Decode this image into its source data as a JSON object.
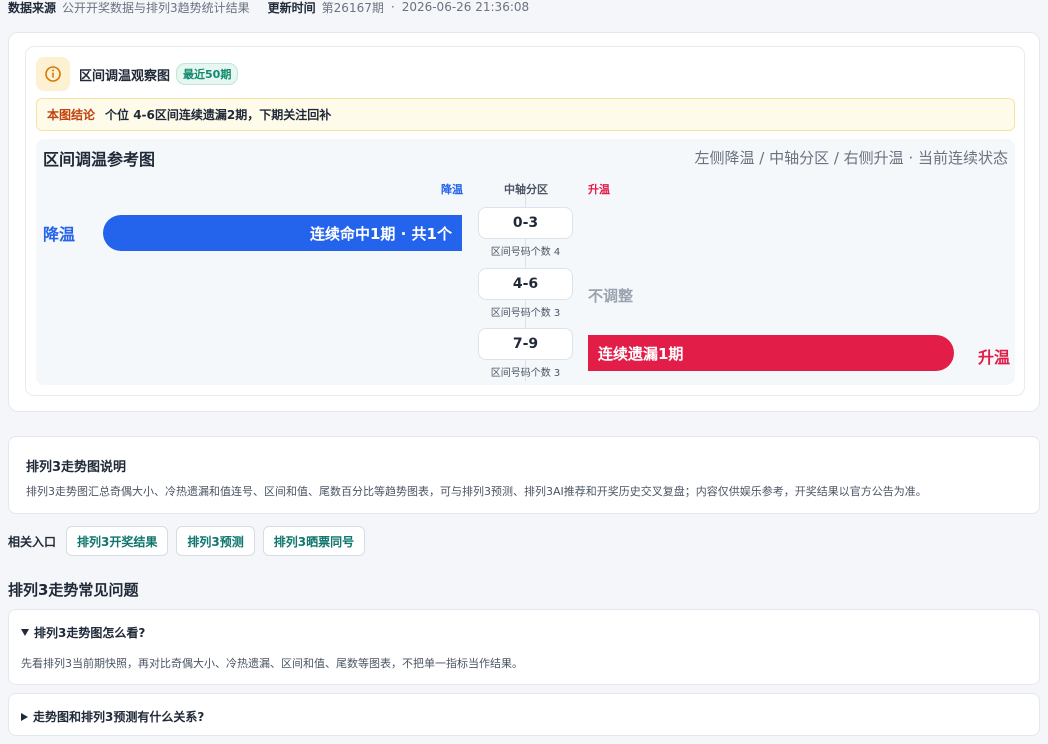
{
  "meta": {
    "source_label": "数据来源",
    "source_value": "公开开奖数据与排列3趋势统计结果",
    "update_label": "更新时间",
    "issue": "第26167期",
    "separator": "·",
    "datetime": "2026-06-26 21:36:08"
  },
  "panel": {
    "title": "区间调温观察图",
    "badge": "最近50期",
    "icon": "info-icon",
    "conclusion_label": "本图结论",
    "conclusion_text": "个位 4-6区间连续遗漏2期，下期关注回补"
  },
  "chart_data": {
    "type": "table",
    "title": "区间调温参考图",
    "subtitle": "左侧降温 / 中轴分区 / 右侧升温 · 当前连续状态",
    "column_headers": {
      "left": "降温",
      "center": "中轴分区",
      "right": "升温"
    },
    "rows": [
      {
        "zone": "0-3",
        "note": "区间号码个数 4",
        "side": "降温",
        "bar_text": "连续命中1期 · 共1个",
        "direction": "left",
        "streak": 1
      },
      {
        "zone": "4-6",
        "note": "区间号码个数 3",
        "side": "",
        "bar_text": "不调整",
        "direction": "none",
        "streak": 0
      },
      {
        "zone": "7-9",
        "note": "区间号码个数 3",
        "side": "升温",
        "bar_text": "连续遗漏1期",
        "direction": "right",
        "streak": 1
      }
    ],
    "colors": {
      "cool": "#2463eb",
      "warm": "#e11d48",
      "neutral": "#9aa3af"
    }
  },
  "description": {
    "title": "排列3走势图说明",
    "body": "排列3走势图汇总奇偶大小、冷热遗漏和值连号、区间和值、尾数百分比等趋势图表，可与排列3预测、排列3AI推荐和开奖历史交叉复盘；内容仅供娱乐参考，开奖结果以官方公告为准。"
  },
  "related": {
    "label": "相关入口",
    "links": [
      "排列3开奖结果",
      "排列3预测",
      "排列3晒票同号"
    ]
  },
  "faq": {
    "heading": "排列3走势常见问题",
    "items": [
      {
        "question": "排列3走势图怎么看?",
        "answer": "先看排列3当前期快照，再对比奇偶大小、冷热遗漏、区间和值、尾数等图表，不把单一指标当作结果。",
        "expanded": true
      },
      {
        "question": "走势图和排列3预测有什么关系?",
        "answer": "",
        "expanded": false
      }
    ]
  }
}
